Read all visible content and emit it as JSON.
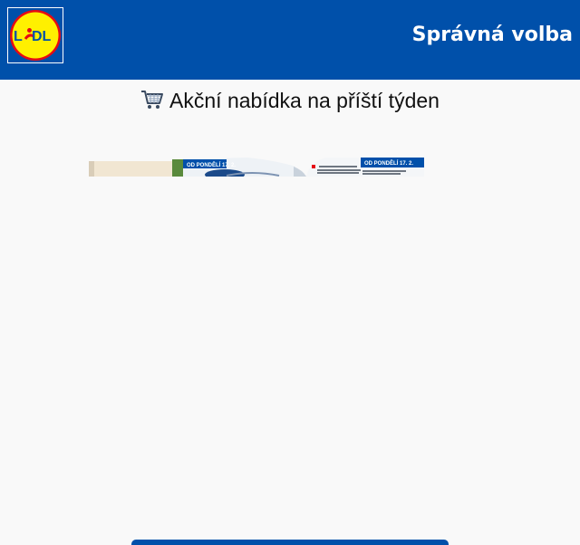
{
  "header": {
    "logo_text": "LIDL",
    "slogan": "Správná volba"
  },
  "offer": {
    "cart_icon": "shopping-cart-icon",
    "heading": "Akční nabídka na příští týden"
  },
  "flyer": {
    "left_page_label": "OD PONDĚLÍ 17. 2.",
    "right_page_label": "OD PONDĚLÍ 17. 2."
  },
  "colors": {
    "brand_blue": "#0050aa",
    "brand_yellow": "#fff000",
    "brand_red": "#e60a14",
    "background": "#f9f9f9"
  }
}
